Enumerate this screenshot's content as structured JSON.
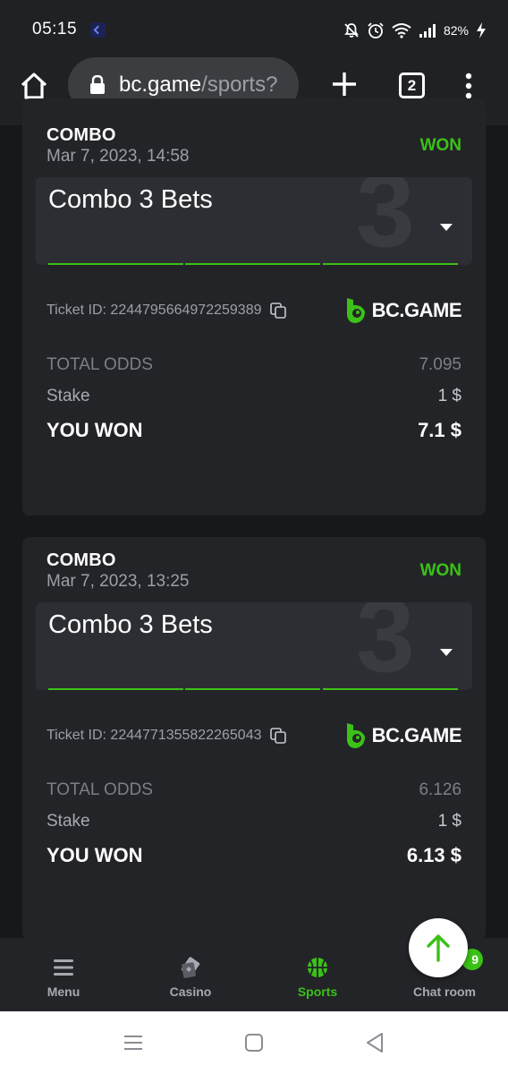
{
  "status_bar": {
    "time": "05:15",
    "battery": "82%"
  },
  "browser": {
    "url_host": "bc.game",
    "url_path": "/sports?",
    "tab_count": "2"
  },
  "bets": [
    {
      "type": "COMBO",
      "date": "Mar 7, 2023, 14:58",
      "status": "WON",
      "combo_title": "Combo 3 Bets",
      "combo_number": "3",
      "ticket_id": "Ticket ID: 2244795664972259389",
      "brand": "BC.GAME",
      "total_odds_label": "TOTAL ODDS",
      "total_odds": "7.095",
      "stake_label": "Stake",
      "stake": "1 $",
      "won_label": "YOU WON",
      "won": "7.1 $"
    },
    {
      "type": "COMBO",
      "date": "Mar 7, 2023, 13:25",
      "status": "WON",
      "combo_title": "Combo 3 Bets",
      "combo_number": "3",
      "ticket_id": "Ticket ID: 2244771355822265043",
      "brand": "BC.GAME",
      "total_odds_label": "TOTAL ODDS",
      "total_odds": "6.126",
      "stake_label": "Stake",
      "stake": "1 $",
      "won_label": "YOU WON",
      "won": "6.13 $"
    }
  ],
  "chat_badge": "9",
  "bottom_nav": {
    "items": [
      {
        "label": "Menu",
        "icon": "menu-icon"
      },
      {
        "label": "Casino",
        "icon": "casino-icon"
      },
      {
        "label": "Sports",
        "icon": "sports-ball-icon",
        "active": true
      },
      {
        "label": "Chat room",
        "icon": "chat-icon"
      }
    ]
  },
  "colors": {
    "accent_green": "#3bc117",
    "card_bg": "#232428",
    "page_bg": "#17181b"
  }
}
